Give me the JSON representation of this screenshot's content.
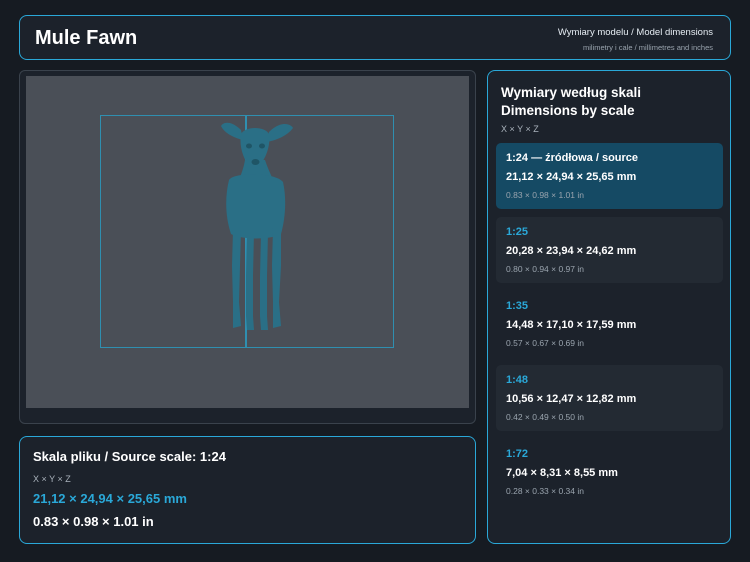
{
  "header": {
    "title": "Mule Fawn",
    "subtitle": "Wymiary modelu / Model dimensions",
    "caption": "milimetry i cale / millimetres and inches"
  },
  "viewer": {
    "model_icon": "fawn-model-icon",
    "colors": {
      "model": "#2a6f86",
      "bbox": "#2f8fb0",
      "viewport": "#4a4f57"
    }
  },
  "source": {
    "title": "Skala pliku / Source scale: 1:24",
    "axes": "X × Y × Z",
    "mm": "21,12 × 24,94 × 25,65 mm",
    "inches": "0.83 × 0.98 × 1.01 in"
  },
  "scales": {
    "title_line1": "Wymiary według skali",
    "title_line2": "Dimensions by scale",
    "axes": "X × Y × Z",
    "items": [
      {
        "label": "1:24  —  źródłowa / source",
        "mm": "21,12 × 24,94 × 25,65 mm",
        "inches": "0.83 × 0.98 × 1.01 in"
      },
      {
        "label": "1:25",
        "mm": "20,28 × 23,94 × 24,62 mm",
        "inches": "0.80 × 0.94 × 0.97 in"
      },
      {
        "label": "1:35",
        "mm": "14,48 × 17,10 × 17,59 mm",
        "inches": "0.57 × 0.67 × 0.69 in"
      },
      {
        "label": "1:48",
        "mm": "10,56 × 12,47 × 12,82 mm",
        "inches": "0.42 × 0.49 × 0.50 in"
      },
      {
        "label": "1:72",
        "mm": "7,04 × 8,31 × 8,55 mm",
        "inches": "0.28 × 0.33 × 0.34 in"
      }
    ]
  }
}
